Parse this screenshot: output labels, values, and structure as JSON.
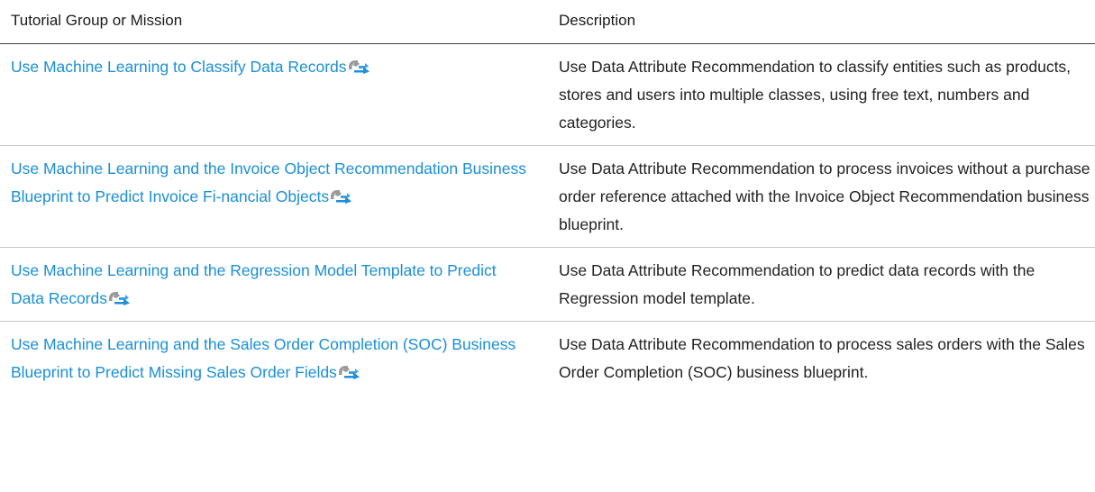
{
  "table": {
    "headers": {
      "mission": "Tutorial Group or Mission",
      "description": "Description"
    },
    "rows": [
      {
        "mission": "Use Machine Learning to Classify Data Records",
        "description": "Use Data Attribute Recommendation to classify entities such as products, stores and users into multiple classes, using free text, numbers and categories."
      },
      {
        "mission": "Use Machine Learning and the Invoice Object Recommendation Business Blueprint to Predict Invoice Fi-nancial Objects",
        "description": "Use Data Attribute Recommendation to process invoices without a purchase order reference attached with the Invoice Object Recommendation business blueprint."
      },
      {
        "mission": "Use Machine Learning and the Regression Model Template to Predict Data Records",
        "description": "Use Data Attribute Recommendation to predict data records with the Regression model template."
      },
      {
        "mission": "Use Machine Learning and the Sales Order Completion (SOC) Business Blueprint to Predict Missing Sales Order Fields",
        "description": "Use Data Attribute Recommendation to process sales orders with the Sales Order Completion (SOC) business blueprint."
      }
    ]
  },
  "icons": {
    "external_link": "external-link-icon"
  },
  "colors": {
    "link": "#1a8fd6",
    "icon_primary": "#1f8fdb",
    "icon_secondary": "#9a9a9a",
    "text": "#222222",
    "header_rule": "#444444",
    "row_rule": "#c8c8c8"
  }
}
